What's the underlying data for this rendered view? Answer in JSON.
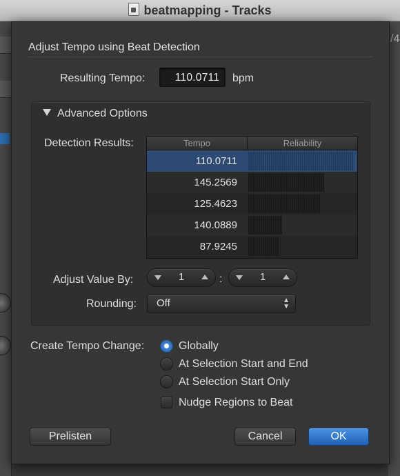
{
  "window": {
    "title": "beatmapping - Tracks"
  },
  "background": {
    "right_fragment": "/4"
  },
  "dialog": {
    "title": "Adjust Tempo using Beat Detection",
    "resulting_tempo_label": "Resulting Tempo:",
    "resulting_tempo_value": "110.0711",
    "resulting_tempo_unit": "bpm",
    "advanced_options_label": "Advanced Options",
    "detection_results_label": "Detection Results:",
    "table": {
      "columns": [
        "Tempo",
        "Reliability"
      ],
      "rows": [
        {
          "tempo": "110.0711",
          "reliability": 1.0,
          "selected": true
        },
        {
          "tempo": "145.2569",
          "reliability": 0.72,
          "selected": false
        },
        {
          "tempo": "125.4623",
          "reliability": 0.68,
          "selected": false
        },
        {
          "tempo": "140.0889",
          "reliability": 0.32,
          "selected": false
        },
        {
          "tempo": "87.9245",
          "reliability": 0.29,
          "selected": false
        }
      ]
    },
    "adjust_value_label": "Adjust Value By:",
    "adjust_value_left": "1",
    "adjust_value_separator": ":",
    "adjust_value_right": "1",
    "rounding_label": "Rounding:",
    "rounding_value": "Off",
    "create_tempo_label": "Create Tempo Change:",
    "options": [
      {
        "label": "Globally",
        "selected": true
      },
      {
        "label": "At Selection Start and End",
        "selected": false
      },
      {
        "label": "At Selection Start Only",
        "selected": false
      }
    ],
    "nudge_label": "Nudge Regions to Beat",
    "nudge_checked": false,
    "buttons": {
      "prelisten": "Prelisten",
      "cancel": "Cancel",
      "ok": "OK"
    }
  },
  "colors": {
    "accent": "#2f6fc4",
    "selected_row": "#2c4a72",
    "dialog_bg": "#363636"
  }
}
